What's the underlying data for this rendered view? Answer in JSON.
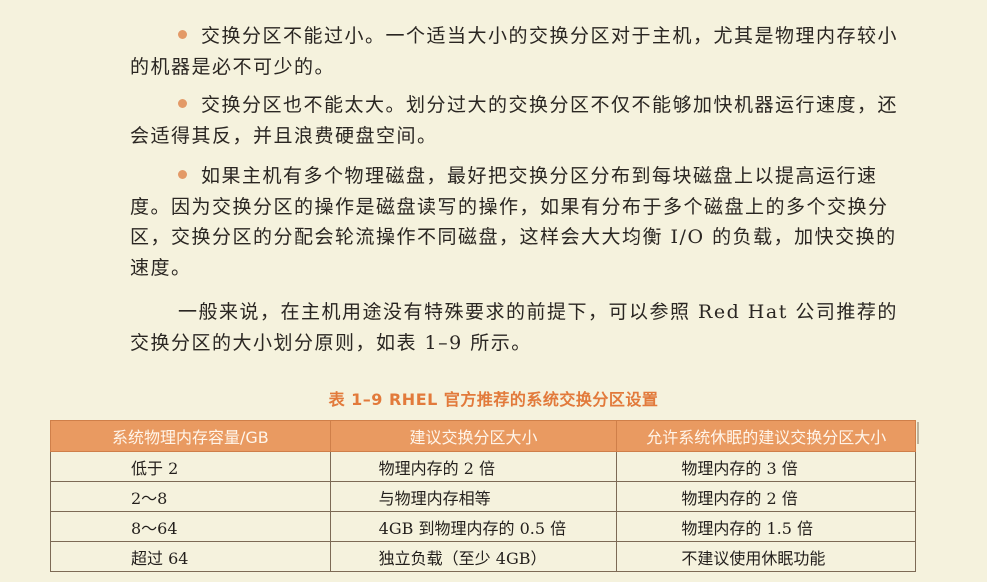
{
  "paragraphs": {
    "p1_bullet": "交换分区不能过小。一个适当大小的交换分区对于主机，尤其是物理内存较小的机器是必不可少的。",
    "p2_bullet": "交换分区也不能太大。划分过大的交换分区不仅不能够加快机器运行速度，还会适得其反，并且浪费硬盘空间。",
    "p3_bullet": "如果主机有多个物理磁盘，最好把交换分区分布到每块磁盘上以提高运行速度。因为交换分区的操作是磁盘读写的操作，如果有分布于多个磁盘上的多个交换分区，交换分区的分配会轮流操作不同磁盘，这样会大大均衡 I/O 的负载，加快交换的速度。",
    "p4": "一般来说，在主机用途没有特殊要求的前提下，可以参照 Red Hat 公司推荐的交换分区的大小划分原则，如表 1–9 所示。"
  },
  "table": {
    "caption": "表 1–9  RHEL 官方推荐的系统交换分区设置",
    "headers": [
      "系统物理内存容量/GB",
      "建议交换分区大小",
      "允许系统休眠的建议交换分区大小"
    ],
    "rows": [
      [
        "低于 2",
        "物理内存的 2 倍",
        "物理内存的 3 倍"
      ],
      [
        "2～8",
        "与物理内存相等",
        "物理内存的 2 倍"
      ],
      [
        "8～64",
        "4GB 到物理内存的 0.5 倍",
        "物理内存的 1.5 倍"
      ],
      [
        "超过 64",
        "独立负载（至少 4GB）",
        "不建议使用休眠功能"
      ]
    ]
  },
  "colors": {
    "background": "#f5f2dd",
    "accent": "#e99a61",
    "caption": "#e27a3b",
    "bullet": "#e39a67"
  }
}
